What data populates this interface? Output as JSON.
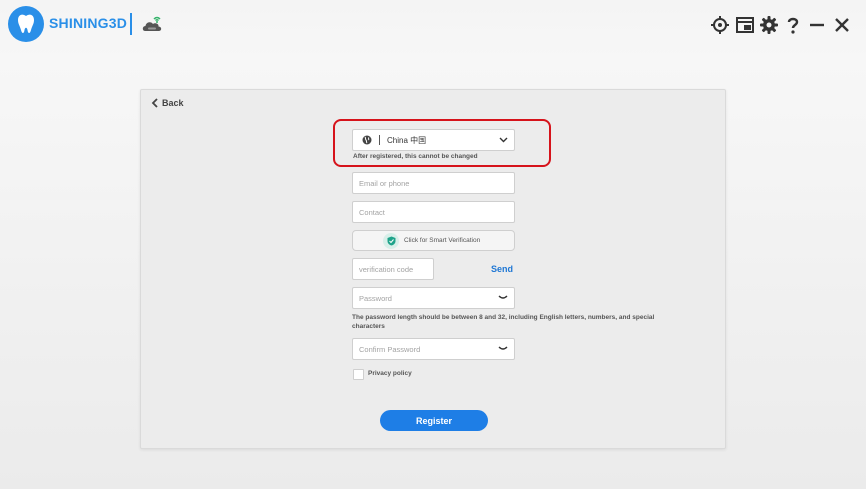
{
  "app": {
    "brand": "SHINING3D",
    "accent": "#2a8fe8"
  },
  "titlebar_icons": [
    "target-icon",
    "screenshot-icon",
    "gear-icon",
    "help-icon",
    "minimize-icon",
    "close-icon"
  ],
  "form": {
    "back_label": "Back",
    "country": {
      "value": "China 中国",
      "hint": "After registered, this cannot be changed"
    },
    "email": {
      "placeholder": "Email or phone",
      "value": ""
    },
    "contact": {
      "placeholder": "Contact",
      "value": ""
    },
    "smart_verification": "Click for Smart Verification",
    "verification_code": {
      "placeholder": "verification code",
      "value": ""
    },
    "send_label": "Send",
    "password": {
      "placeholder": "Password",
      "value": ""
    },
    "password_hint": "The password length should be between 8 and 32, including English letters, numbers, and special characters",
    "confirm_password": {
      "placeholder": "Confirm Password",
      "value": ""
    },
    "privacy_label": "Privacy policy",
    "privacy_checked": false,
    "register_label": "Register"
  },
  "colors": {
    "highlight": "#d6131b",
    "button": "#1e7ee6",
    "link": "#1f77d4"
  }
}
